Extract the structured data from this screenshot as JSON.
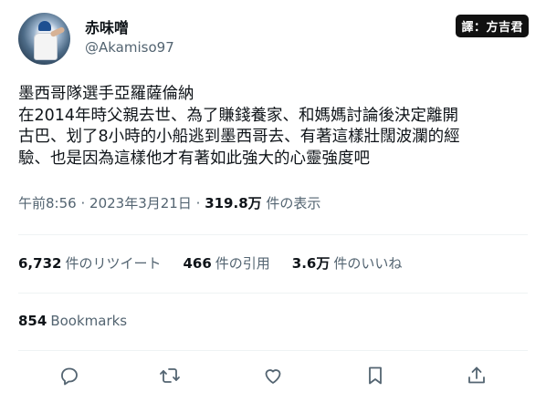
{
  "author": {
    "display_name": "赤味噌",
    "handle": "@Akamiso97"
  },
  "watermark": "譯：方吉君",
  "tweet": {
    "lines": [
      "墨西哥隊選手亞羅薩倫納",
      "在2014年時父親去世、為了賺錢養家、和媽媽討論後決定離開",
      "古巴、划了8小時的小船逃到墨西哥去、有著這樣壯闊波瀾的經",
      "驗、也是因為這樣他才有著如此強大的心靈強度吧"
    ]
  },
  "meta": {
    "time": "午前8:56",
    "separator": "·",
    "date": "2023年3月21日",
    "separator2": "·",
    "views_count": "319.8万",
    "views_label": "件の表示"
  },
  "stats": {
    "retweets_count": "6,732",
    "retweets_label": "件のリツイート",
    "quotes_count": "466",
    "quotes_label": "件の引用",
    "likes_count": "3.6万",
    "likes_label": "件のいいね"
  },
  "bookmarks": {
    "count": "854",
    "label": "Bookmarks"
  },
  "actions": [
    {
      "icon": "reply-icon"
    },
    {
      "icon": "retweet-icon"
    },
    {
      "icon": "like-icon"
    },
    {
      "icon": "bookmark-icon"
    },
    {
      "icon": "share-icon"
    }
  ]
}
